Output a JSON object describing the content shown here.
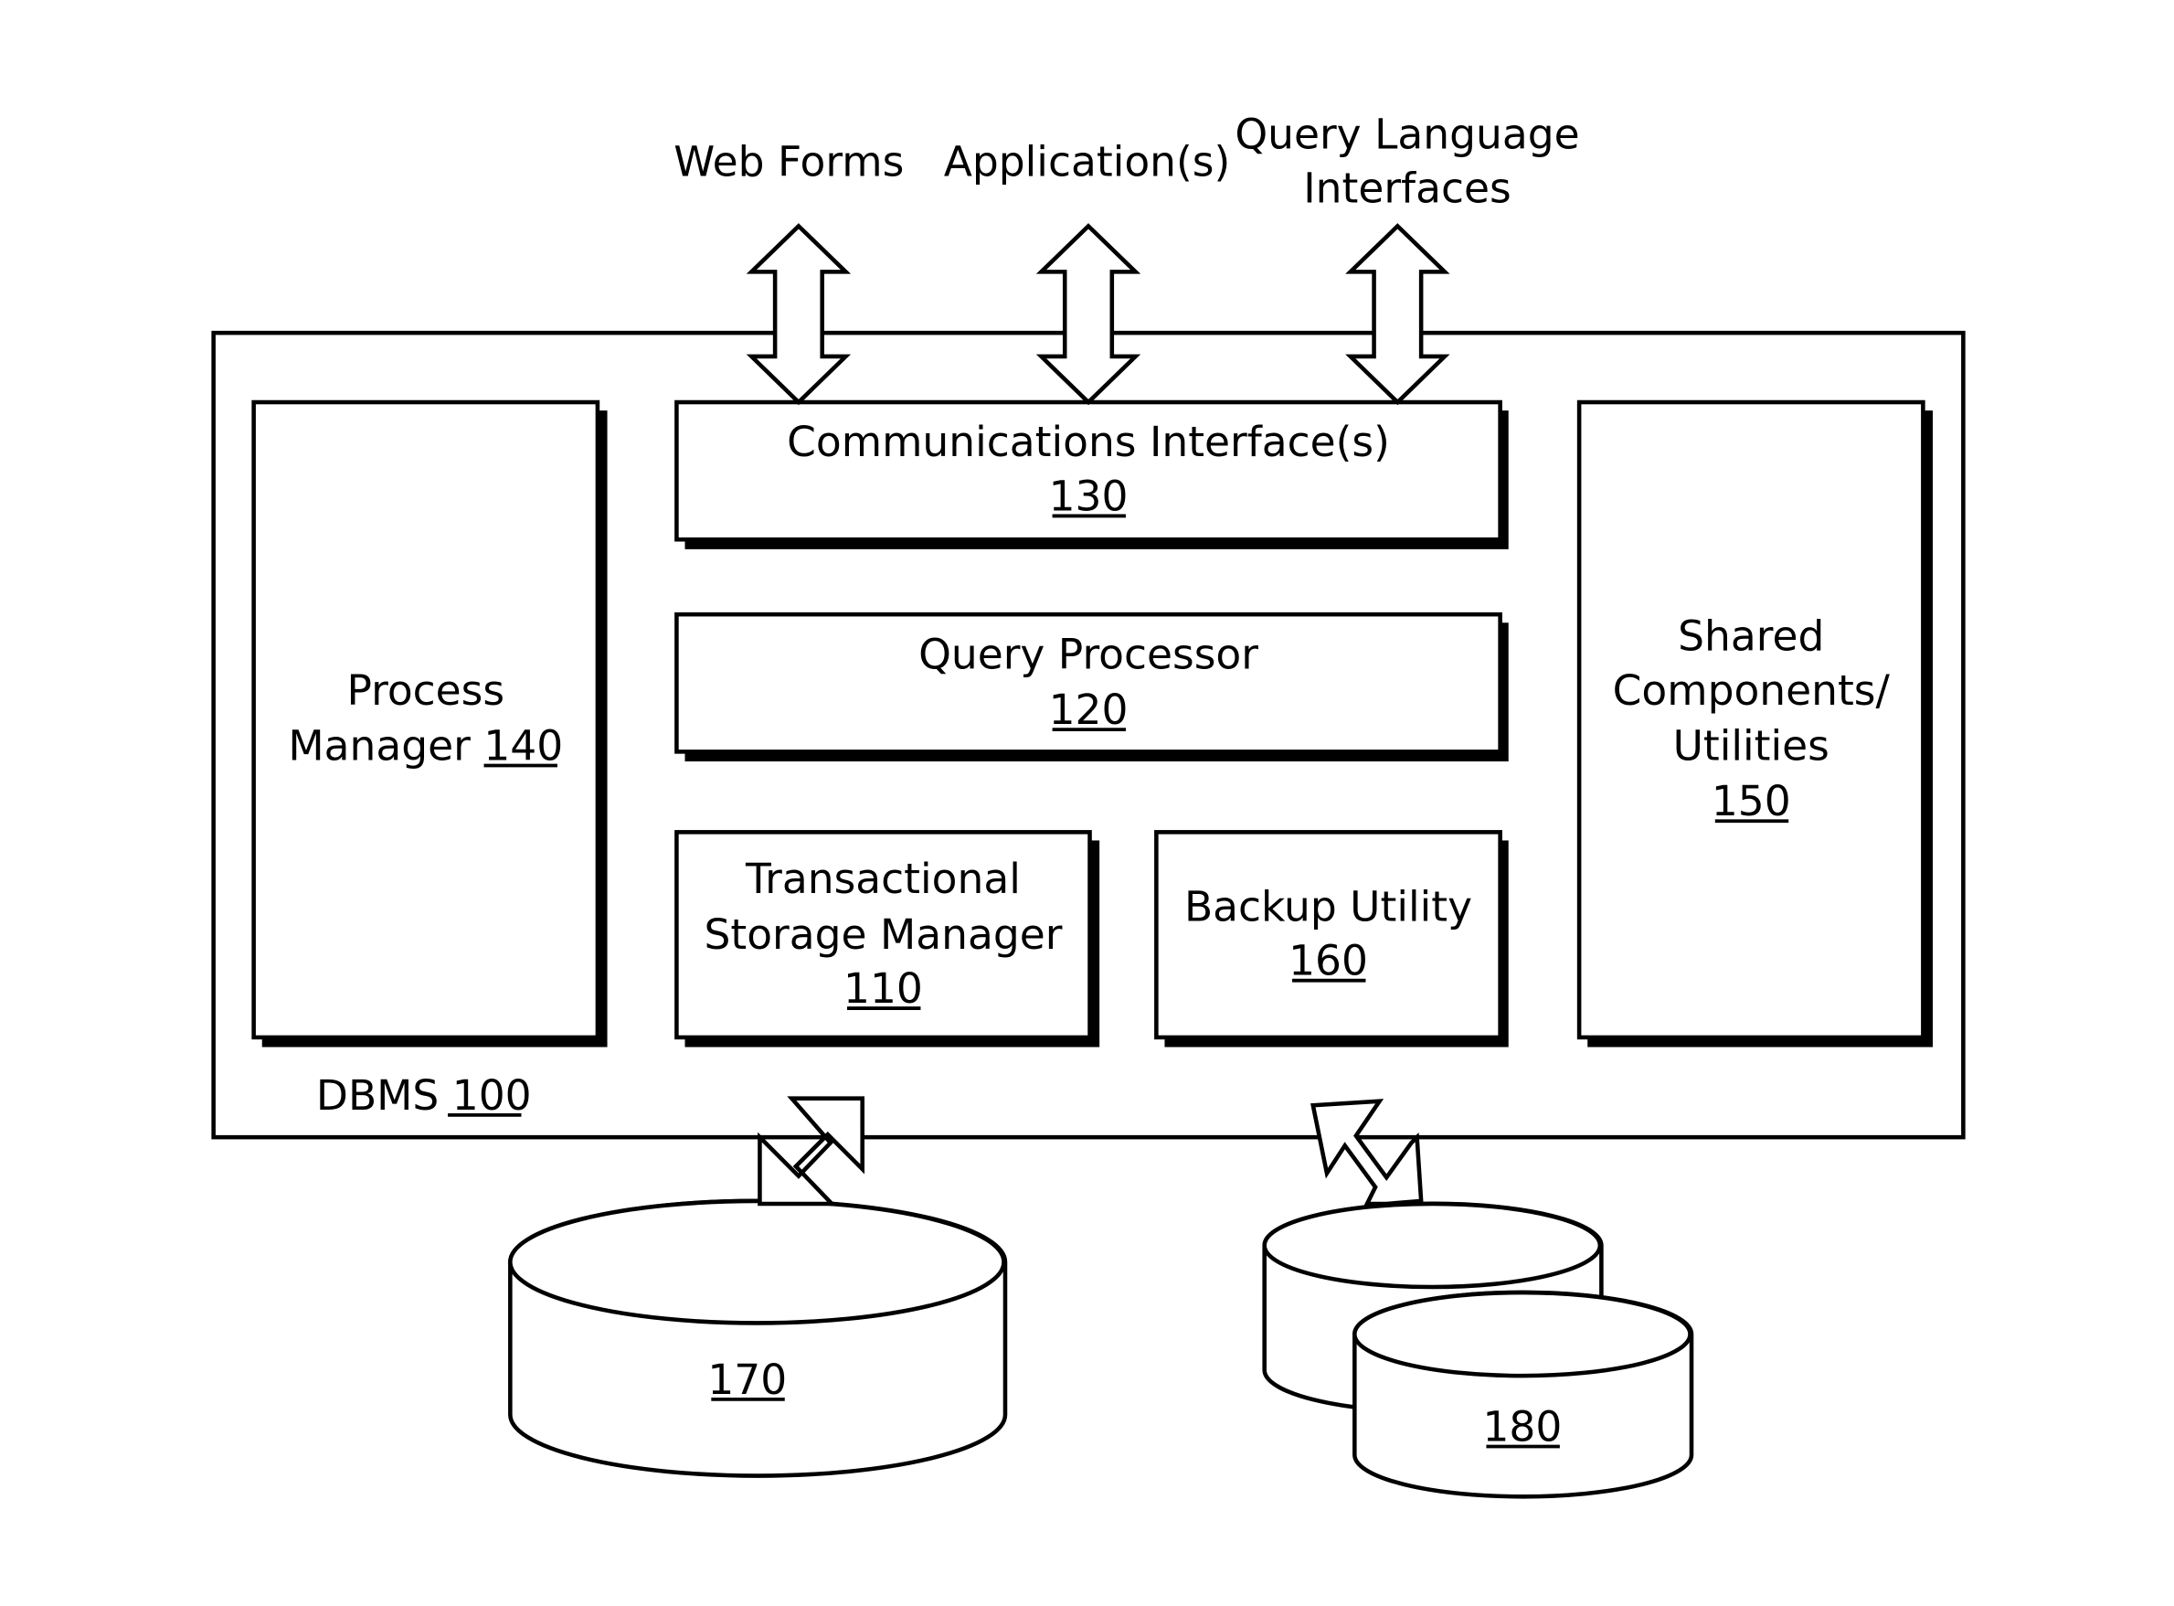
{
  "external_interfaces": [
    {
      "label": "Web Forms"
    },
    {
      "label": "Application(s)"
    },
    {
      "label_line1": "Query Language",
      "label_line2": "Interfaces"
    }
  ],
  "dbms": {
    "label": "DBMS",
    "ref": "100"
  },
  "components": {
    "process_manager": {
      "line1": "Process",
      "line2": "Manager",
      "ref": "140"
    },
    "communications_interface": {
      "line1": "Communications Interface(s)",
      "ref": "130"
    },
    "query_processor": {
      "line1": "Query Processor",
      "ref": "120"
    },
    "transactional_storage_manager": {
      "line1": "Transactional",
      "line2": "Storage Manager",
      "ref": "110"
    },
    "backup_utility": {
      "line1": "Backup Utility",
      "ref": "160"
    },
    "shared_components": {
      "line1": "Shared",
      "line2": "Components/",
      "line3": "Utilities",
      "ref": "150"
    }
  },
  "storage": {
    "database": {
      "ref": "170"
    },
    "backup_storage": {
      "ref": "180"
    }
  }
}
